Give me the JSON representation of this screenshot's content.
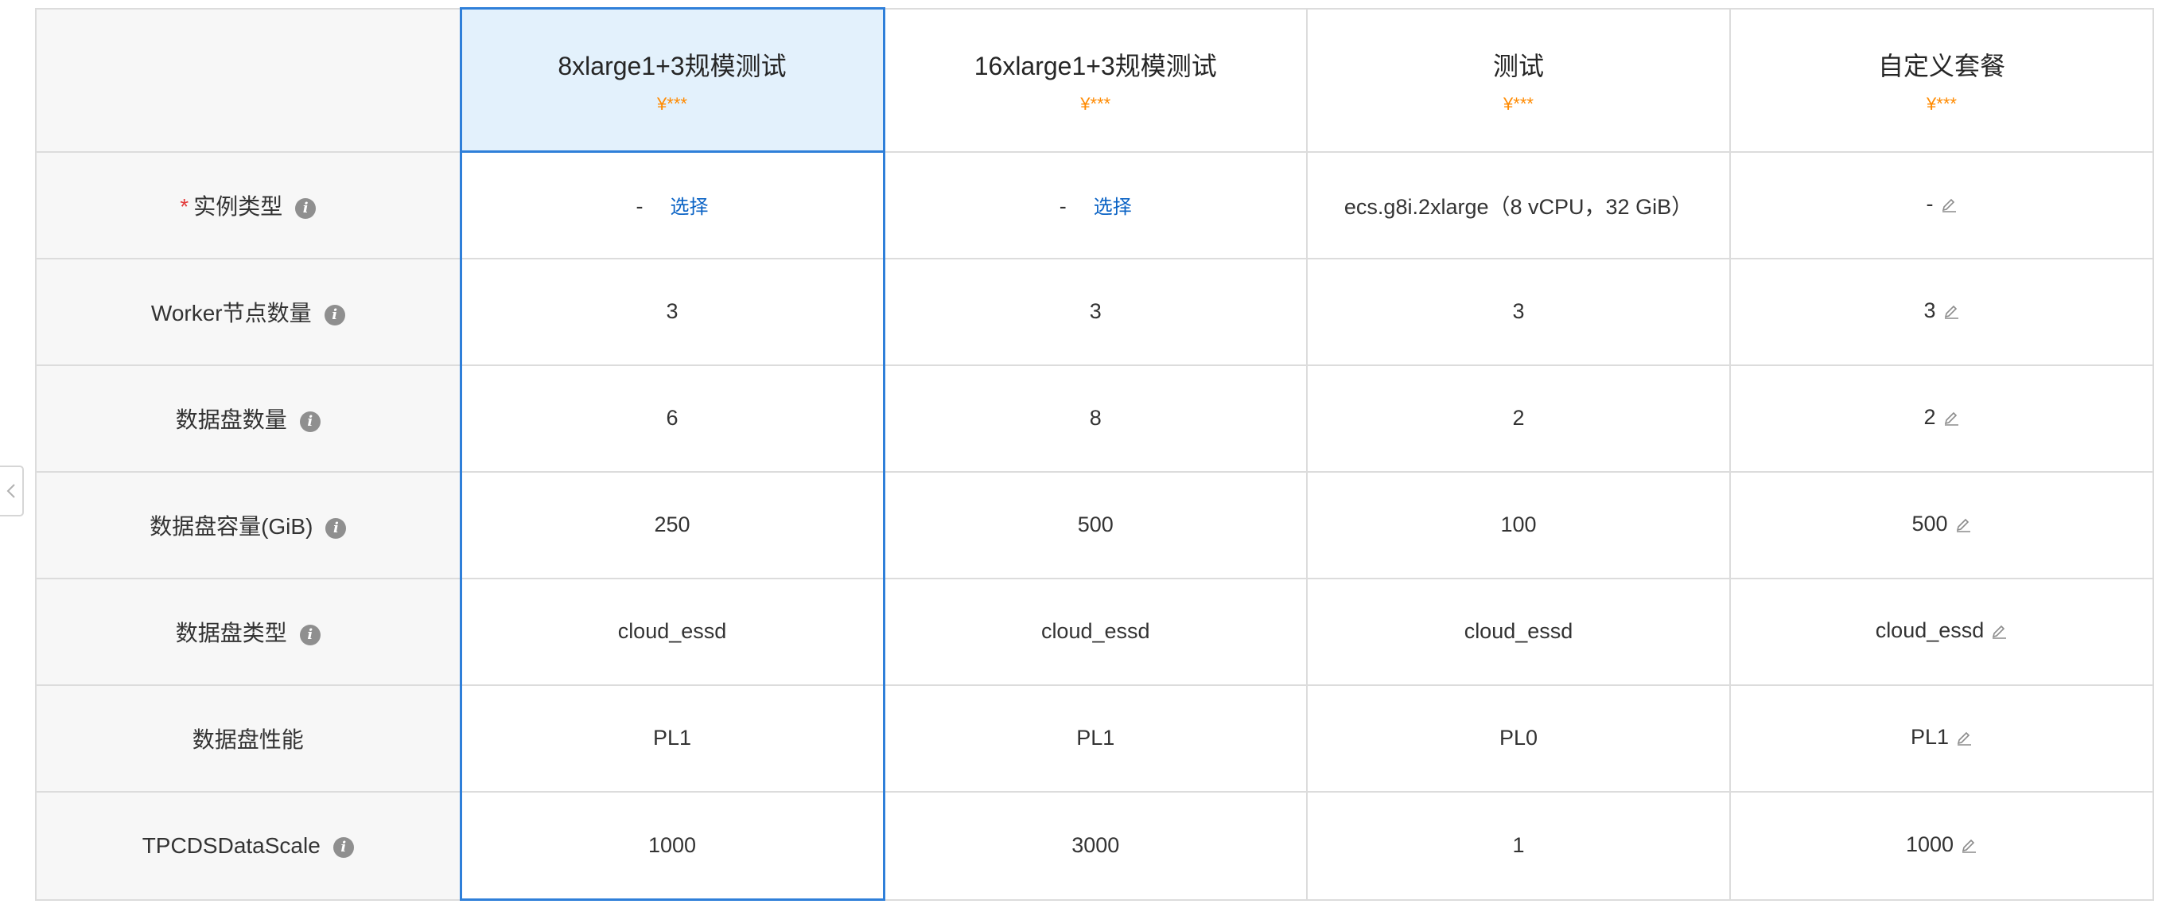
{
  "plans": [
    {
      "name": "8xlarge1+3规模测试",
      "price": "¥***"
    },
    {
      "name": "16xlarge1+3规模测试",
      "price": "¥***"
    },
    {
      "name": "测试",
      "price": "¥***"
    },
    {
      "name": "自定义套餐",
      "price": "¥***"
    }
  ],
  "rows": {
    "instance_type": {
      "label": "实例类型",
      "required_mark": "*",
      "values": [
        "-",
        "-",
        "ecs.g8i.2xlarge（8 vCPU，32 GiB）",
        "-"
      ],
      "select_label": "选择"
    },
    "worker_nodes": {
      "label": "Worker节点数量",
      "values": [
        "3",
        "3",
        "3",
        "3"
      ]
    },
    "disk_count": {
      "label": "数据盘数量",
      "values": [
        "6",
        "8",
        "2",
        "2"
      ]
    },
    "disk_capacity": {
      "label": "数据盘容量(GiB)",
      "values": [
        "250",
        "500",
        "100",
        "500"
      ]
    },
    "disk_type": {
      "label": "数据盘类型",
      "values": [
        "cloud_essd",
        "cloud_essd",
        "cloud_essd",
        "cloud_essd"
      ]
    },
    "disk_performance": {
      "label": "数据盘性能",
      "values": [
        "PL1",
        "PL1",
        "PL0",
        "PL1"
      ]
    },
    "tpcds_scale": {
      "label": "TPCDSDataScale",
      "values": [
        "1000",
        "3000",
        "1",
        "1000"
      ]
    }
  },
  "icons": {
    "info": "info-icon",
    "edit": "edit-pencil-icon",
    "collapse": "chevron-left-icon"
  },
  "colors": {
    "selected_border": "#2f7fd9",
    "selected_bg": "#e3f1fc",
    "price": "#ff8a00",
    "link": "#0b63c5",
    "required": "#e33b3b"
  }
}
